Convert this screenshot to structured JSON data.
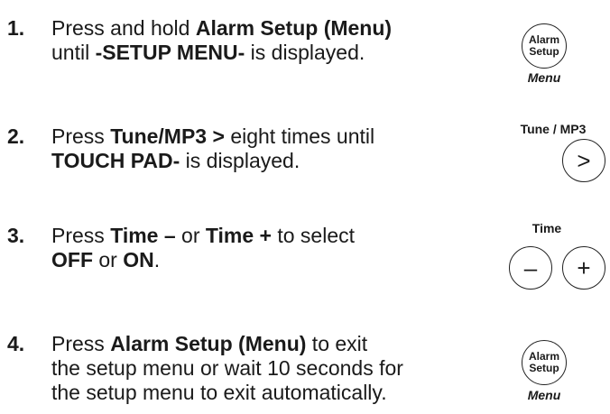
{
  "steps": [
    {
      "number": "1.",
      "line1": [
        "Press and hold ",
        "Alarm Setup (Menu)"
      ],
      "line2": [
        "until ",
        "-SETUP MENU-",
        " is displayed."
      ]
    },
    {
      "number": "2.",
      "line1": [
        "Press ",
        "Tune/MP3 >",
        " eight times until"
      ],
      "line2": [
        "TOUCH PAD-",
        " is displayed."
      ]
    },
    {
      "number": "3.",
      "line1": [
        "Press ",
        "Time –",
        " or ",
        "Time +",
        " to select"
      ],
      "line2": [
        "OFF",
        " or ",
        "ON",
        "."
      ]
    },
    {
      "number": "4.",
      "line1": [
        "Press ",
        "Alarm Setup (Menu)",
        " to exit"
      ],
      "line2": [
        "the setup menu or wait 10 seconds for"
      ],
      "line3": [
        "the setup menu to exit automatically."
      ]
    }
  ],
  "buttons": {
    "alarm1": {
      "line1": "Alarm",
      "line2": "Setup",
      "caption": "Menu"
    },
    "tune": {
      "caption": "Tune / MP3",
      "symbol": ">"
    },
    "time": {
      "caption": "Time",
      "minus": "–",
      "plus": "+"
    },
    "alarm2": {
      "line1": "Alarm",
      "line2": "Setup",
      "caption": "Menu"
    }
  }
}
